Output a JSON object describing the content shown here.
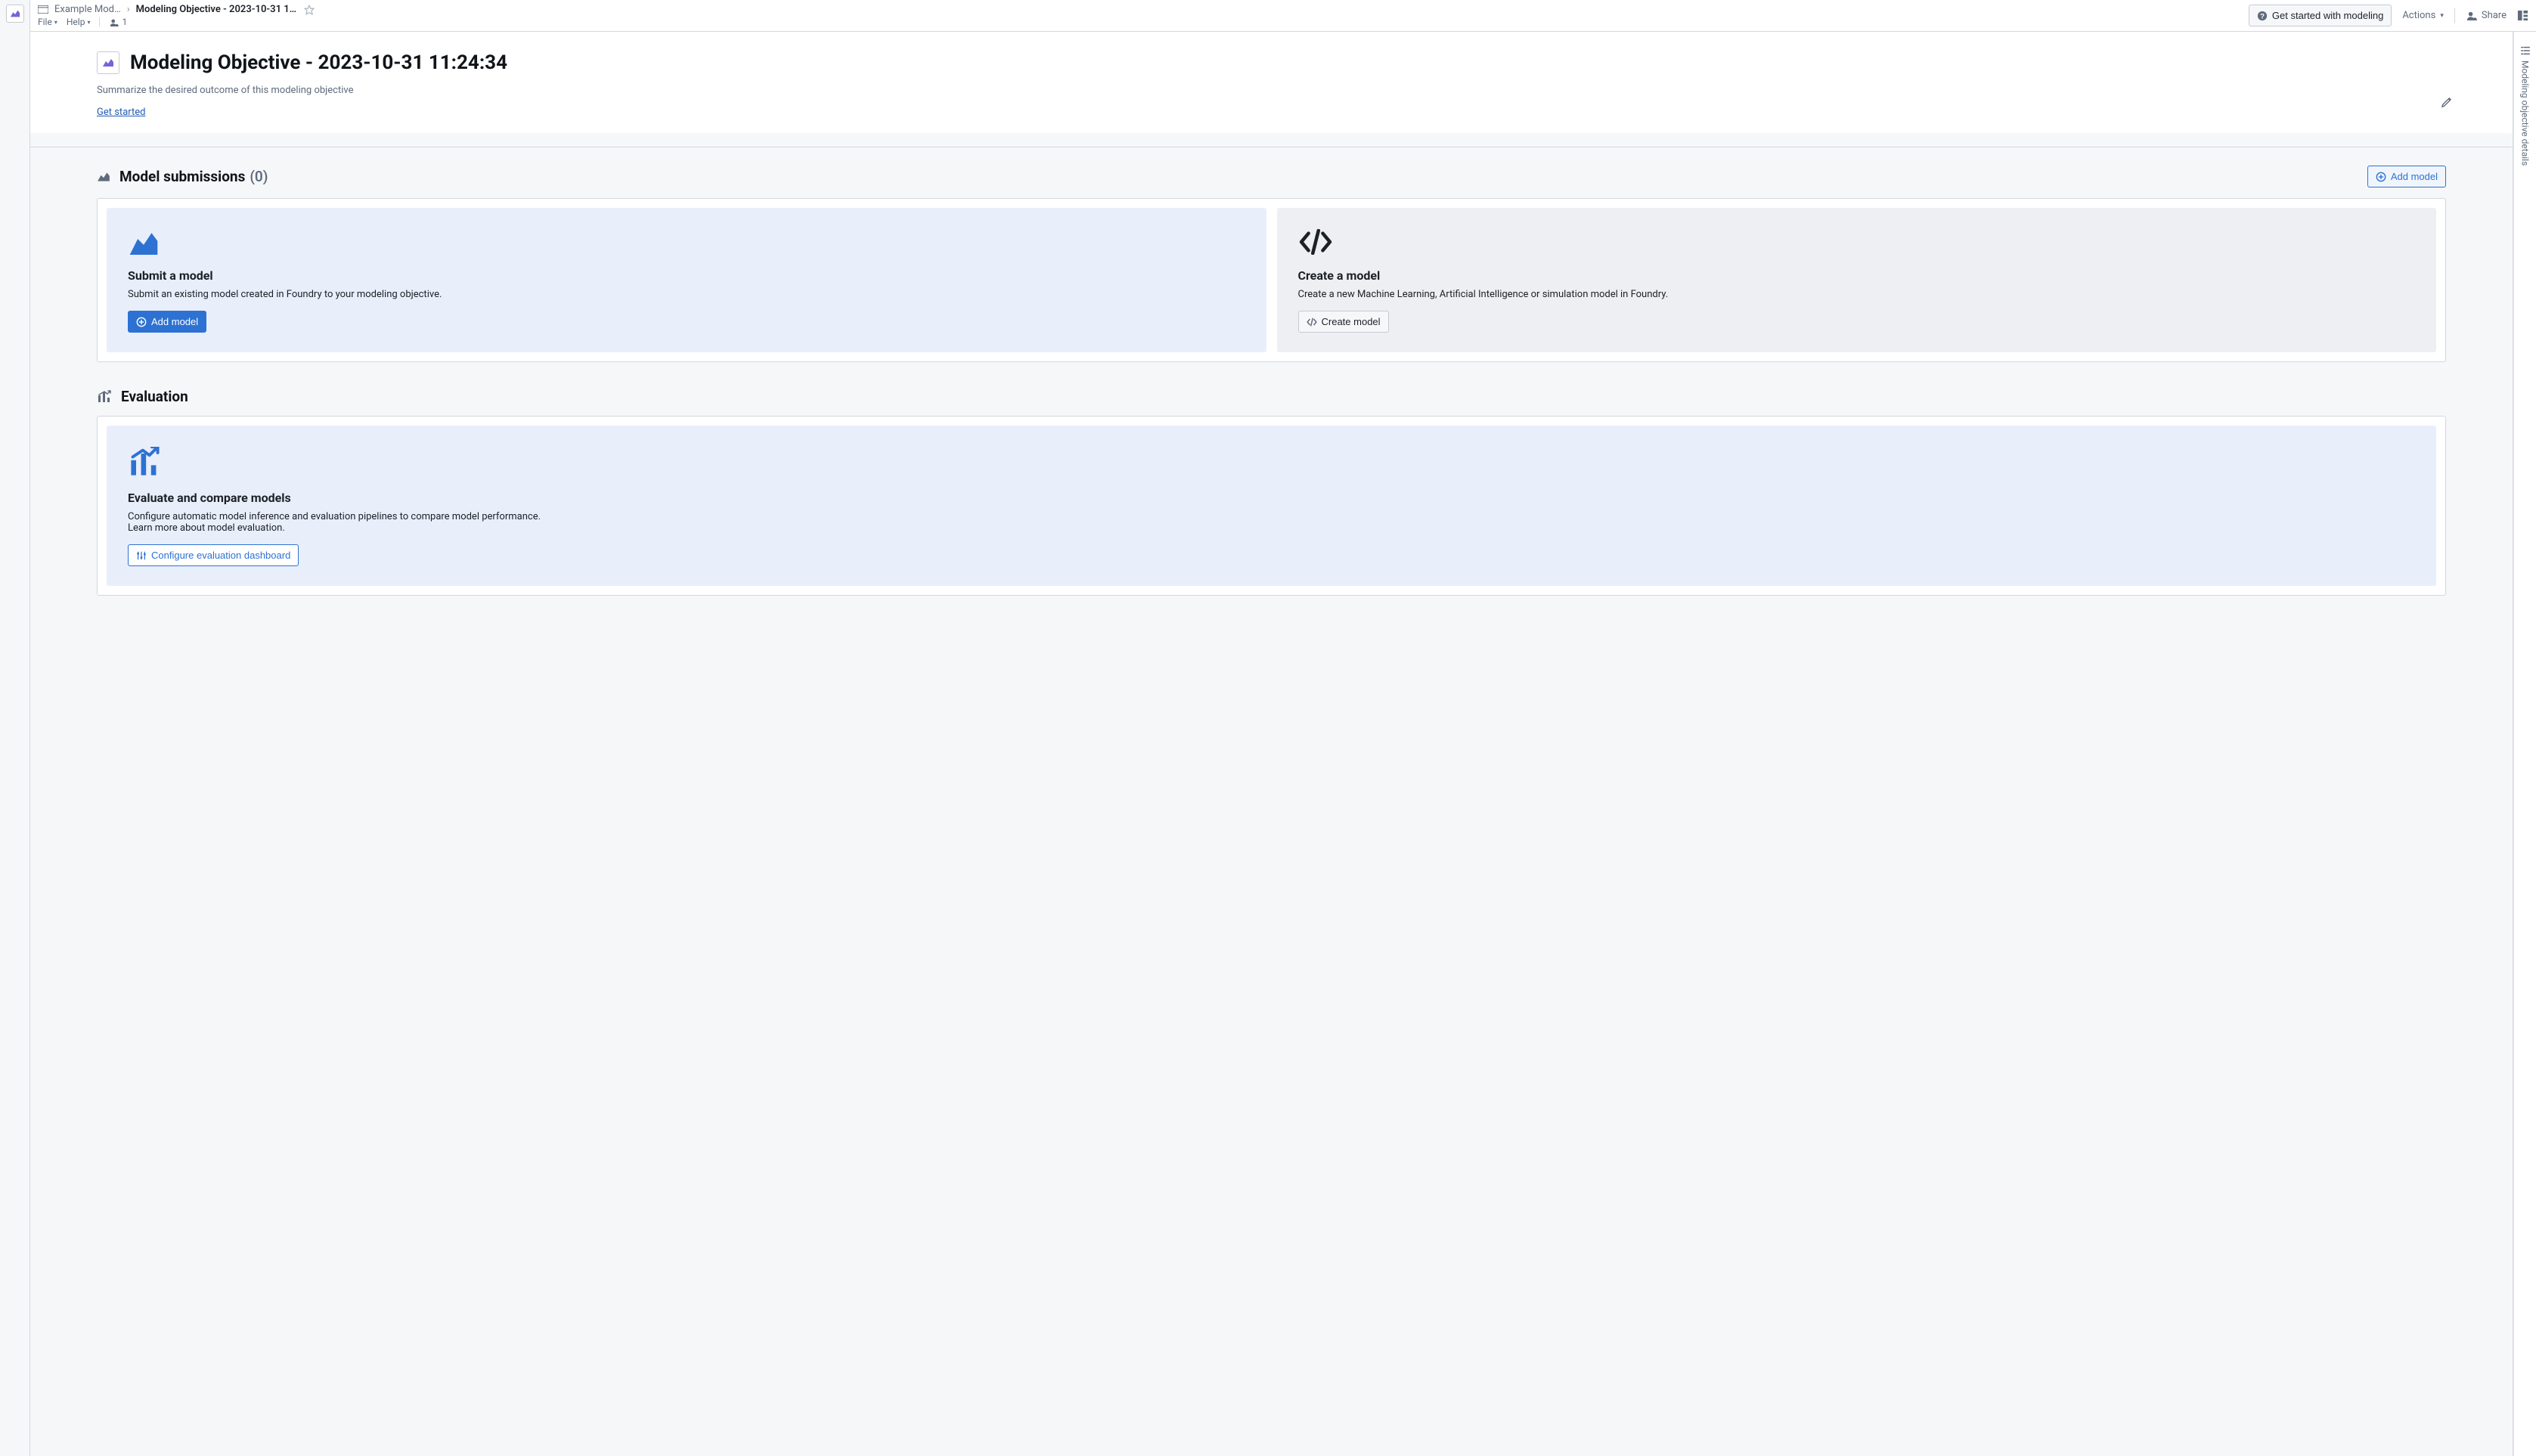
{
  "breadcrumb": {
    "folder": "Example Mod…",
    "title": "Modeling Objective - 2023-10-31 1…"
  },
  "menus": {
    "file": "File",
    "help": "Help",
    "users_count": "1"
  },
  "topbar": {
    "get_started": "Get started with modeling",
    "actions": "Actions",
    "share": "Share"
  },
  "right_rail": {
    "label": "Modeling objective details"
  },
  "header": {
    "title": "Modeling Objective - 2023-10-31 11:24:34",
    "subtitle": "Summarize the desired outcome of this modeling objective",
    "get_started_link": "Get started"
  },
  "submissions": {
    "title": "Model submissions",
    "count": "(0)",
    "add_model": "Add model",
    "submit_card": {
      "title": "Submit a model",
      "desc": "Submit an existing model created in Foundry to your modeling objective.",
      "button": "Add model"
    },
    "create_card": {
      "title": "Create a model",
      "desc": "Create a new Machine Learning, Artificial Intelligence or simulation model in Foundry.",
      "button": "Create model"
    }
  },
  "evaluation": {
    "title": "Evaluation",
    "card": {
      "title": "Evaluate and compare models",
      "desc": "Configure automatic model inference and evaluation pipelines to compare model performance.",
      "learn_more": "Learn more about model evaluation.",
      "button": "Configure evaluation dashboard"
    }
  }
}
